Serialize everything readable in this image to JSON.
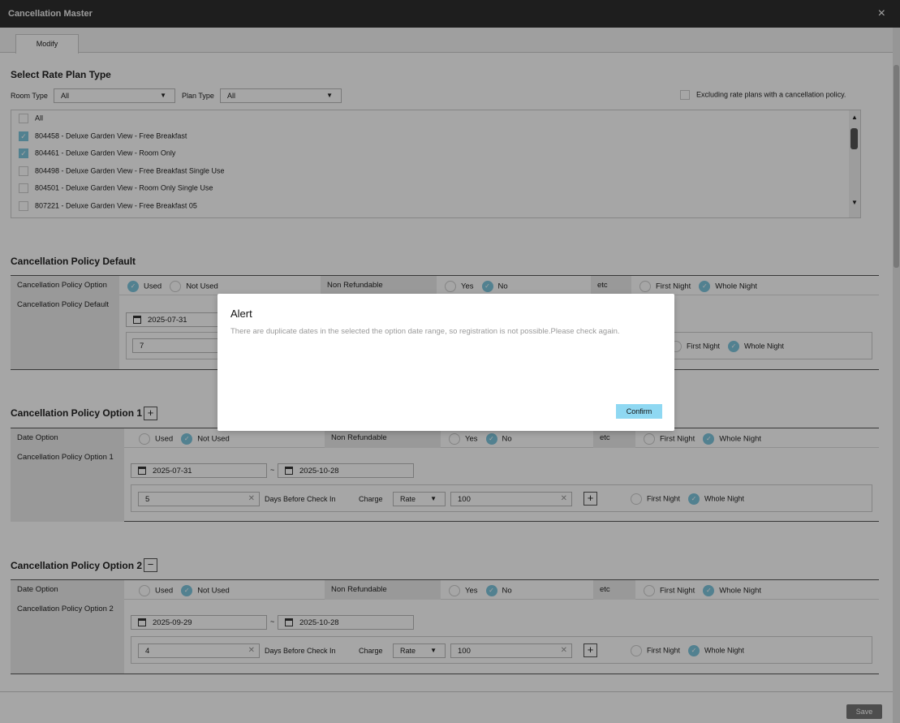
{
  "window": {
    "title": "Cancellation Master",
    "close_icon": "×"
  },
  "tabs": [
    {
      "label": "Modify"
    }
  ],
  "rate_plan": {
    "title": "Select Rate Plan Type",
    "room_type_label": "Room Type",
    "room_type_value": "All",
    "plan_type_label": "Plan Type",
    "plan_type_value": "All",
    "exclude_label": "Excluding rate plans with a cancellation policy.",
    "items": [
      {
        "label": "All",
        "checked": false
      },
      {
        "label": "804458 - Deluxe Garden View - Free Breakfast",
        "checked": true
      },
      {
        "label": "804461 - Deluxe Garden View - Room Only",
        "checked": true
      },
      {
        "label": "804498 - Deluxe Garden View - Free Breakfast Single Use",
        "checked": false
      },
      {
        "label": "804501 - Deluxe Garden View - Room Only Single Use",
        "checked": false
      },
      {
        "label": "807221 - Deluxe Garden View - Free Breakfast 05",
        "checked": false
      }
    ]
  },
  "common": {
    "used": "Used",
    "not_used": "Not Used",
    "non_refundable": "Non Refundable",
    "yes": "Yes",
    "no": "No",
    "etc": "etc",
    "first_night": "First Night",
    "whole_night": "Whole Night",
    "days_before": "Days Before Check In",
    "charge": "Charge",
    "dash": "~"
  },
  "default": {
    "title": "Cancellation Policy Default",
    "row1_label": "Cancellation Policy Option",
    "row2_label": "Cancellation Policy Default",
    "start_date": "2025-07-31",
    "days": "7"
  },
  "option1": {
    "title": "Cancellation Policy Option 1",
    "row1_label": "Date Option",
    "row2_label": "Cancellation Policy Option 1",
    "start_date": "2025-07-31",
    "end_date": "2025-10-28",
    "days": "5",
    "charge_type": "Rate",
    "charge_value": "100"
  },
  "option2": {
    "title": "Cancellation Policy Option 2",
    "row1_label": "Date Option",
    "row2_label": "Cancellation Policy Option 2",
    "start_date": "2025-09-29",
    "end_date": "2025-10-28",
    "days": "4",
    "charge_type": "Rate",
    "charge_value": "100"
  },
  "footer": {
    "save": "Save"
  },
  "alert": {
    "title": "Alert",
    "message": "There are duplicate dates in the selected the option date range, so registration is not possible.Please check again.",
    "confirm": "Confirm"
  }
}
